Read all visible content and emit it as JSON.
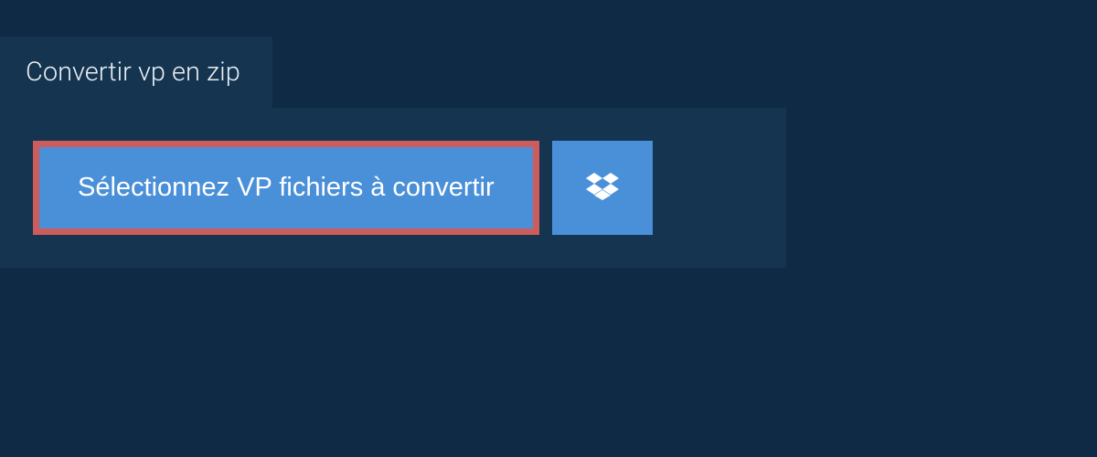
{
  "tab": {
    "title": "Convertir vp en zip"
  },
  "panel": {
    "select_button_label": "Sélectionnez VP fichiers à convertir"
  }
}
